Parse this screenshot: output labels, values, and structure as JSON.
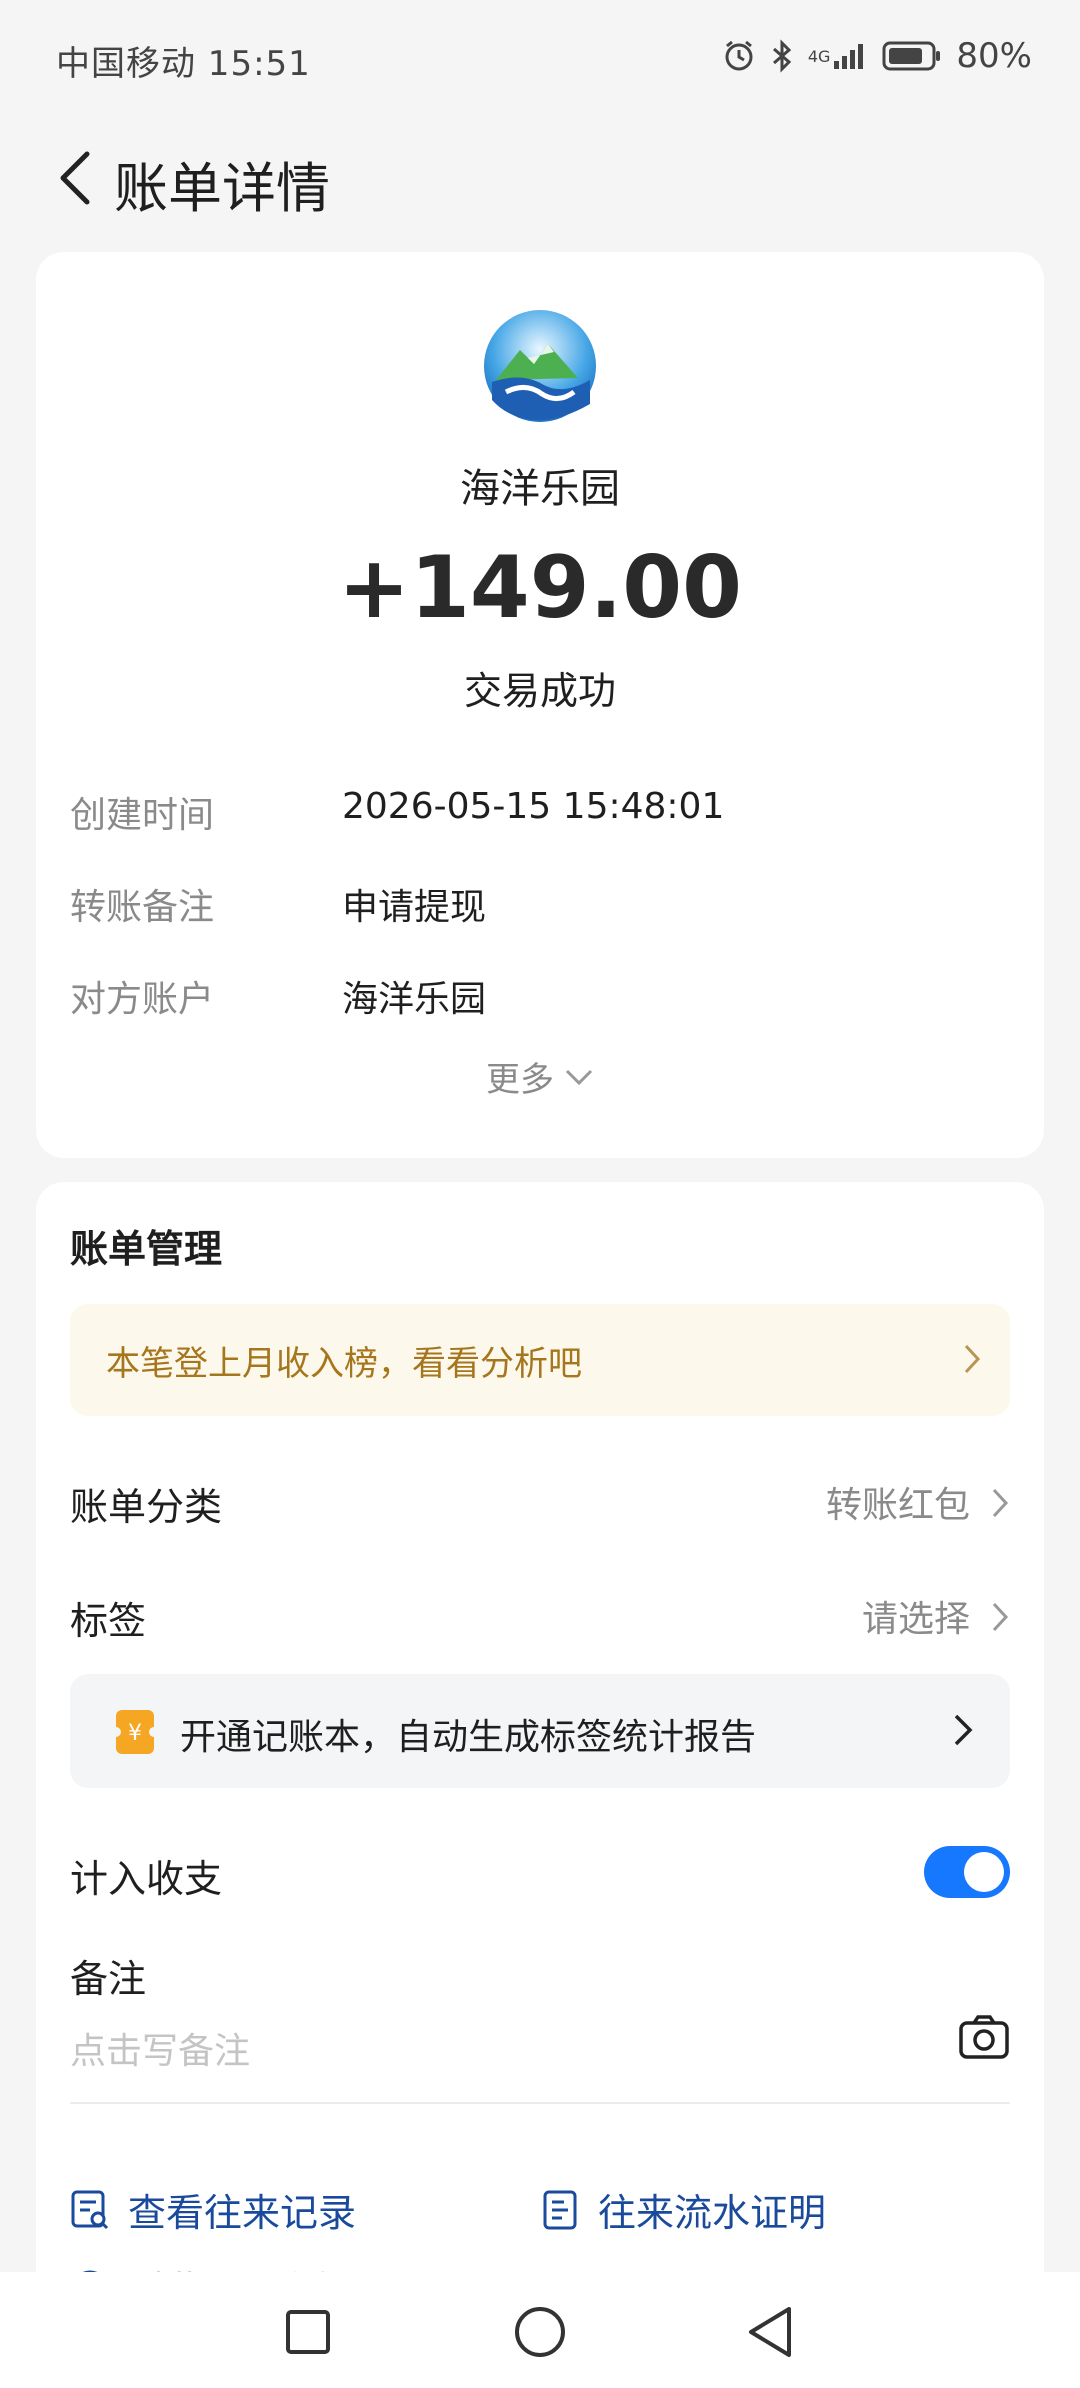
{
  "status_bar": {
    "carrier_time": "中国移动 15:51",
    "network": "4G",
    "battery": "80%",
    "icons": [
      "alarm-icon",
      "bluetooth-icon",
      "signal-icon",
      "battery-icon"
    ]
  },
  "header": {
    "title": "账单详情",
    "back_icon": "chevron-left-icon"
  },
  "transaction": {
    "merchant_name": "海洋乐园",
    "amount": "+149.00",
    "status": "交易成功",
    "details": [
      {
        "label": "创建时间",
        "value": "2026-05-15 15:48:01"
      },
      {
        "label": "转账备注",
        "value": "申请提现"
      },
      {
        "label": "对方账户",
        "value": "海洋乐园"
      }
    ],
    "more_label": "更多"
  },
  "management": {
    "title": "账单管理",
    "promo_text": "本笔登上月收入榜，看看分析吧",
    "category_label": "账单分类",
    "category_value": "转账红包",
    "tag_label": "标签",
    "tag_value": "请选择",
    "book_banner_text": "开通记账本，自动生成标签统计报告",
    "book_icon_char": "¥",
    "income_label": "计入收支",
    "income_toggle_on": true,
    "remark_label": "备注",
    "remark_placeholder": "点击写备注",
    "links": [
      {
        "label": "查看往来记录",
        "icon": "records-search-icon"
      },
      {
        "label": "往来流水证明",
        "icon": "document-icon"
      },
      {
        "label": "对此订单有疑问",
        "icon": "question-icon"
      }
    ]
  },
  "colors": {
    "accent_blue": "#1677ff",
    "link_blue": "#1a4a9c",
    "promo_text": "#a5761c",
    "promo_bg": "#fdf8ec",
    "book_icon": "#f5a623"
  },
  "nav_bar": {
    "buttons": [
      "recents-square-icon",
      "home-circle-icon",
      "back-triangle-icon"
    ]
  }
}
